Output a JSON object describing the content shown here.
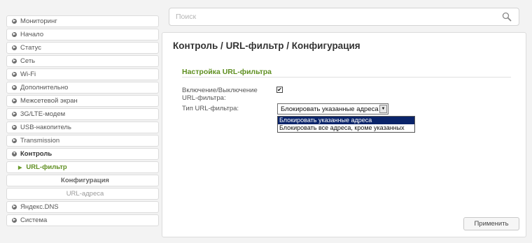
{
  "search": {
    "placeholder": "Поиск"
  },
  "sidebar": {
    "items": [
      {
        "label": "Мониторинг"
      },
      {
        "label": "Начало"
      },
      {
        "label": "Статус"
      },
      {
        "label": "Сеть"
      },
      {
        "label": "Wi-Fi"
      },
      {
        "label": "Дополнительно"
      },
      {
        "label": "Межсетевой экран"
      },
      {
        "label": "3G/LTE-модем"
      },
      {
        "label": "USB-накопитель"
      },
      {
        "label": "Transmission"
      },
      {
        "label": "Контроль"
      },
      {
        "label": "URL-фильтр"
      },
      {
        "label": "Конфигурация"
      },
      {
        "label": "URL-адреса"
      },
      {
        "label": "Яндекс.DNS"
      },
      {
        "label": "Система"
      }
    ]
  },
  "breadcrumb": {
    "part1": "Контроль /",
    "part2": "URL-фильтр /",
    "part3": "Конфигурация"
  },
  "section": {
    "title": "Настройка URL-фильтра"
  },
  "form": {
    "enable_label_line1": "Включение/Выключение",
    "enable_label_line2": "URL-фильтра:",
    "enable_checked": true,
    "type_label": "Тип URL-фильтра:",
    "type_selected": "Блокировать указанные адреса",
    "type_options": [
      "Блокировать указанные адреса",
      "Блокировать все адреса, кроме указанных"
    ]
  },
  "actions": {
    "apply_label": "Применить"
  },
  "colors": {
    "accent_green": "#5f8f21",
    "selection_blue": "#0a246a"
  }
}
